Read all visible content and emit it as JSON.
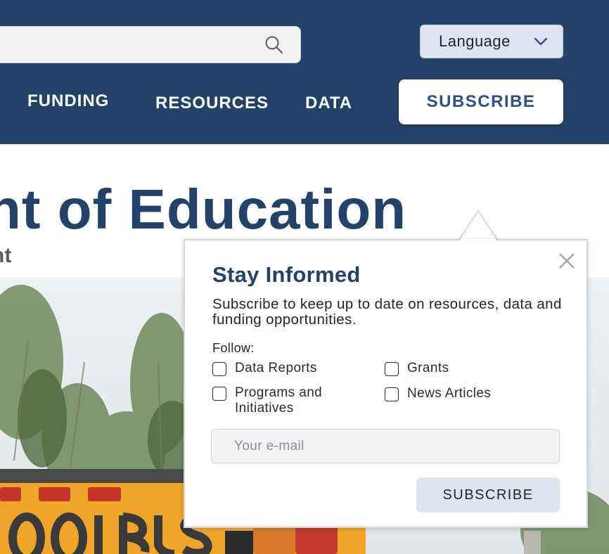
{
  "header": {
    "search": {
      "placeholder": ""
    },
    "language": {
      "label": "Language"
    },
    "nav": {
      "funding": "FUNDING",
      "resources": "RESOURCES",
      "data": "DATA"
    },
    "subscribe_label": "SUBSCRIBE"
  },
  "hero": {
    "title": "nt of Education",
    "subtitle": "nt"
  },
  "popup": {
    "title": "Stay Informed",
    "description": "Subscribe to keep up to date on resources, data and funding opportunities.",
    "follow_label": "Follow:",
    "options": [
      {
        "label": "Data Reports",
        "checked": false
      },
      {
        "label": "Grants",
        "checked": false
      },
      {
        "label": "Programs and Initiatives",
        "checked": false
      },
      {
        "label": "News Articles",
        "checked": false
      }
    ],
    "email": {
      "placeholder": "Your e-mail",
      "value": ""
    },
    "subscribe_label": "SUBSCRIBE"
  },
  "colors": {
    "header_bg": "#22426a",
    "brand_blue": "#2f5089",
    "button_light": "#dde6f0",
    "bus_yellow": "#f0a428"
  },
  "icons": {
    "search": "search-icon",
    "language_toggle": "chevron-down-icon",
    "close": "close-icon"
  }
}
